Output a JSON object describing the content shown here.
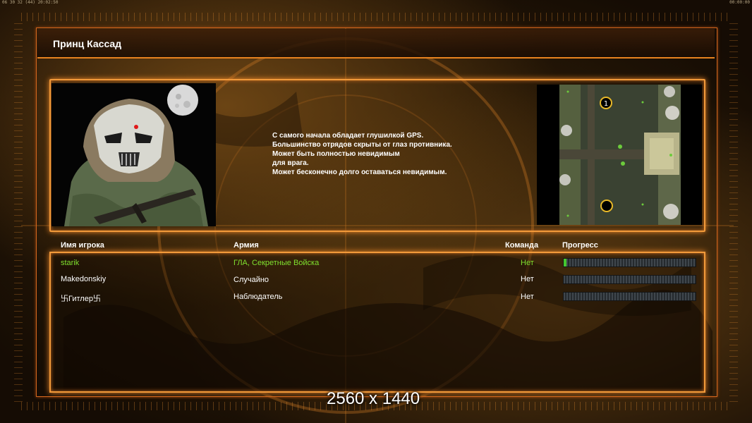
{
  "status_bar": {
    "left_text": "06 30 32 (44) 20:02:50",
    "right_text": "00:00:00"
  },
  "title": "Принц Кассад",
  "description_lines": [
    "С самого начала обладает глушилкой GPS.",
    "Большинство отрядов скрыты от глаз противника.",
    "Может быть полностью невидимым",
    "для врага.",
    "Может бесконечно долго оставаться невидимым."
  ],
  "portrait": {
    "icon": "general-portrait-masked-soldier"
  },
  "minimap": {
    "icon": "minimap",
    "start_markers": [
      "1",
      ""
    ]
  },
  "players_table": {
    "headers": {
      "name": "Имя игрока",
      "army": "Армия",
      "team": "Команда",
      "progress": "Прогресс"
    },
    "rows": [
      {
        "name": "starik",
        "army": "ГЛА, Секретные Войска",
        "team": "Нет",
        "progress": 0.02,
        "color": "#7fe02e"
      },
      {
        "name": "Makedonskiy",
        "army": "Случайно",
        "team": "Нет",
        "progress": 0,
        "color": "#ffffff"
      },
      {
        "name": "卐Гитлер卐",
        "army": "Наблюдатель",
        "team": "Нет",
        "progress": 0,
        "color": "#ffffff"
      }
    ]
  },
  "resolution_overlay": "2560 x 1440",
  "colors": {
    "accent": "#f29a3a",
    "highlight_player": "#7fe02e",
    "progress_fill": "#45c630"
  }
}
